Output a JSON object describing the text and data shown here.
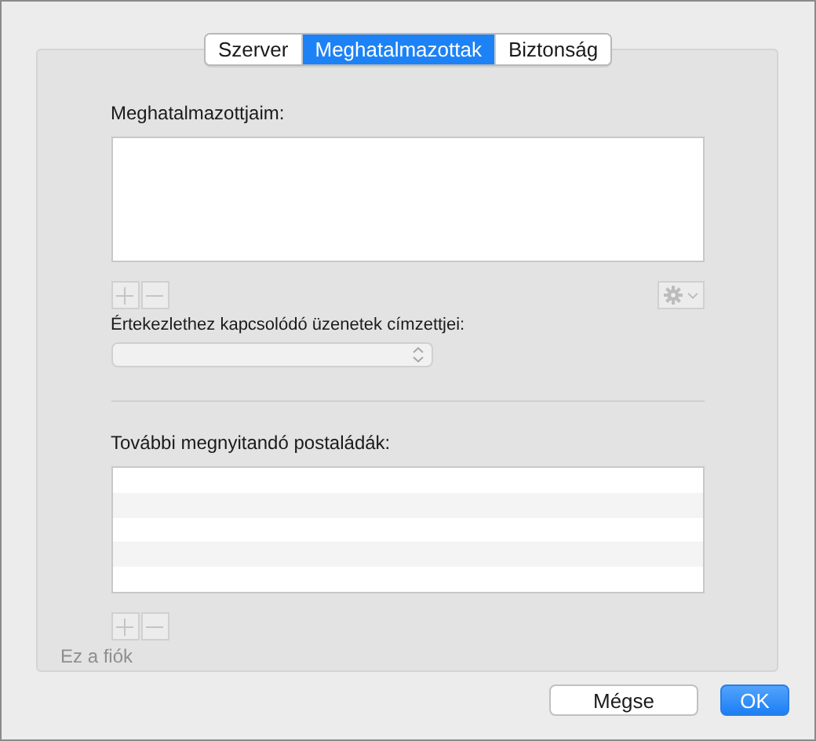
{
  "tabs": [
    {
      "label": "Szerver",
      "selected": false
    },
    {
      "label": "Meghatalmazottak",
      "selected": true
    },
    {
      "label": "Biztonság",
      "selected": false
    }
  ],
  "delegates": {
    "label": "Meghatalmazottjaim:",
    "add_disabled": true,
    "remove_disabled": true,
    "actions_disabled": true
  },
  "meeting_recipients": {
    "label": "Értekezlethez kapcsolódó üzenetek címzettjei:",
    "disabled": true
  },
  "mailboxes": {
    "label": "További megnyitandó postaládák:",
    "add_disabled": true,
    "remove_disabled": true
  },
  "account": {
    "label": "Ez a fiók",
    "disabled": true
  },
  "buttons": [
    {
      "label": "Mégse",
      "kind": "cancel"
    },
    {
      "label": "OK",
      "kind": "default"
    }
  ]
}
